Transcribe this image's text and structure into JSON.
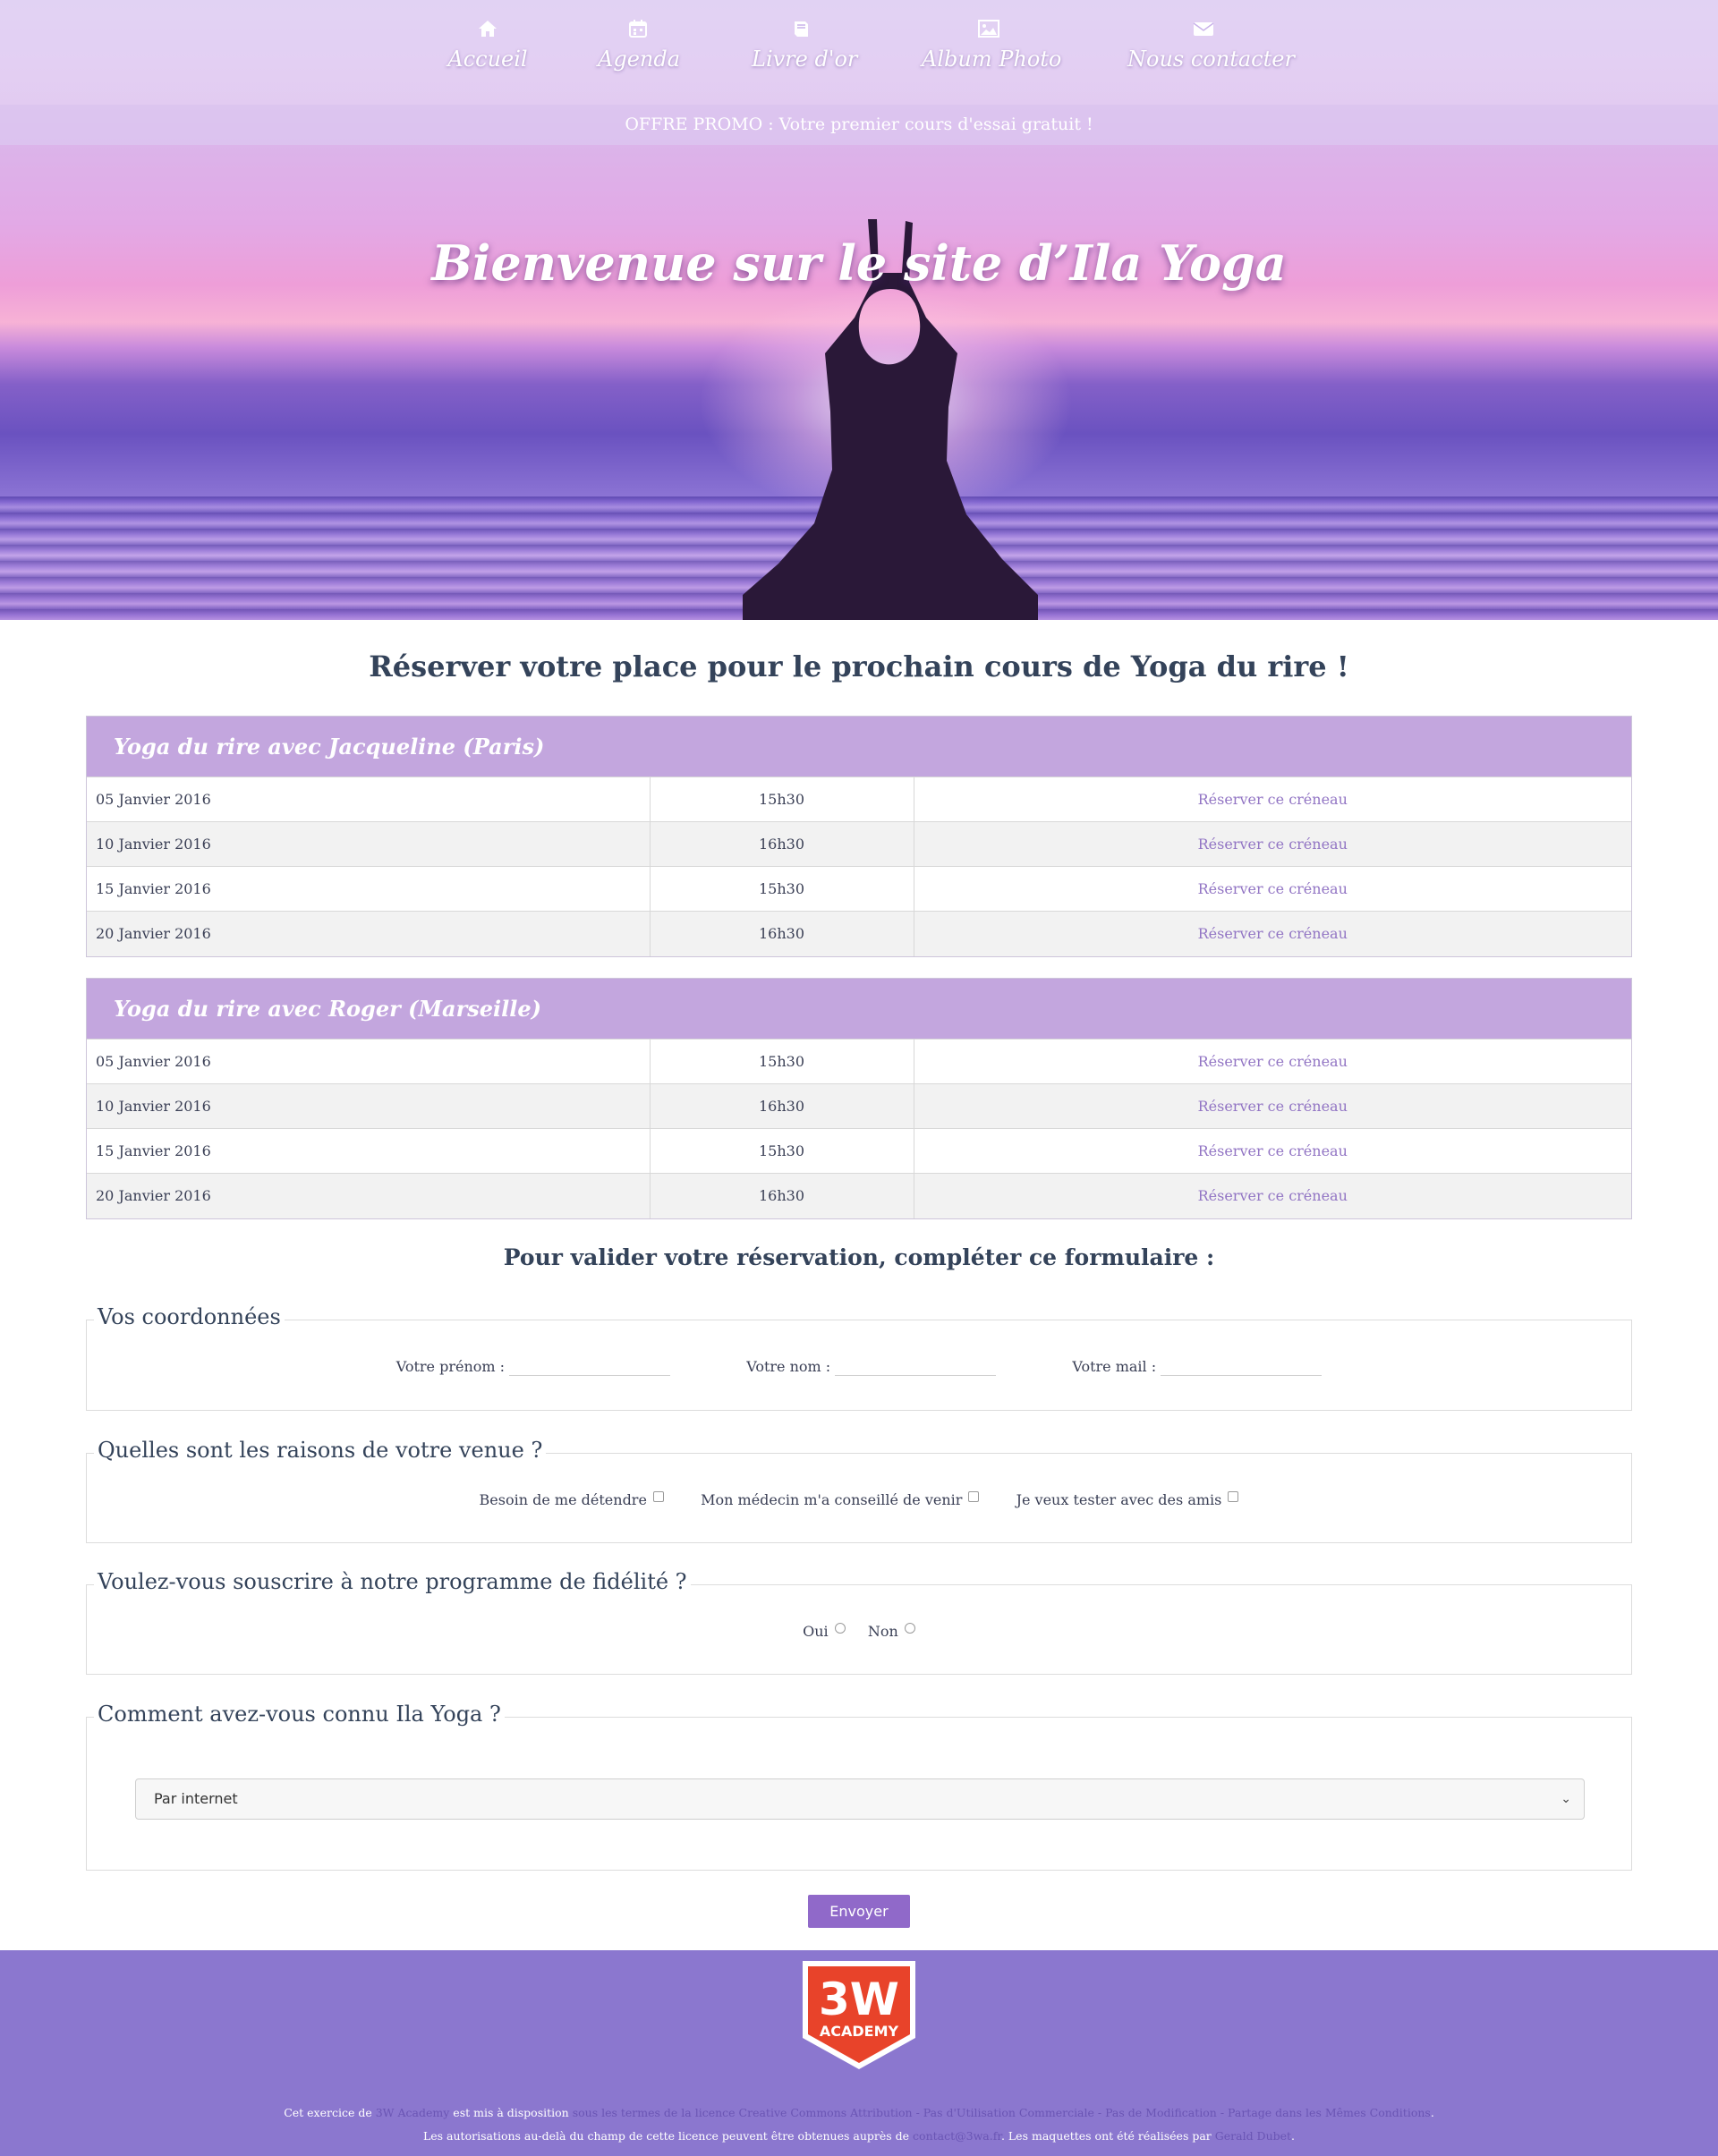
{
  "nav": {
    "items": [
      {
        "label": "Accueil",
        "icon": "home-icon"
      },
      {
        "label": "Agenda",
        "icon": "calendar-icon"
      },
      {
        "label": "Livre d'or",
        "icon": "book-icon"
      },
      {
        "label": "Album Photo",
        "icon": "picture-icon"
      },
      {
        "label": "Nous contacter",
        "icon": "envelope-icon"
      }
    ]
  },
  "promo": "OFFRE PROMO : Votre premier cours d'essai gratuit !",
  "hero": {
    "title": "Bienvenue sur le site d’Ila Yoga"
  },
  "booking": {
    "title": "Réserver votre place pour le prochain cours de Yoga du rire !",
    "schedules": [
      {
        "heading": "Yoga du rire avec Jacqueline (Paris)",
        "rows": [
          {
            "date": "05 Janvier 2016",
            "time": "15h30",
            "link": "Réserver ce créneau"
          },
          {
            "date": "10 Janvier 2016",
            "time": "16h30",
            "link": "Réserver ce créneau"
          },
          {
            "date": "15 Janvier 2016",
            "time": "15h30",
            "link": "Réserver ce créneau"
          },
          {
            "date": "20 Janvier 2016",
            "time": "16h30",
            "link": "Réserver ce créneau"
          }
        ]
      },
      {
        "heading": "Yoga du rire avec Roger (Marseille)",
        "rows": [
          {
            "date": "05 Janvier 2016",
            "time": "15h30",
            "link": "Réserver ce créneau"
          },
          {
            "date": "10 Janvier 2016",
            "time": "16h30",
            "link": "Réserver ce créneau"
          },
          {
            "date": "15 Janvier 2016",
            "time": "15h30",
            "link": "Réserver ce créneau"
          },
          {
            "date": "20 Janvier 2016",
            "time": "16h30",
            "link": "Réserver ce créneau"
          }
        ]
      }
    ]
  },
  "form": {
    "title": "Pour valider votre réservation, compléter ce formulaire :",
    "contact": {
      "legend": "Vos coordonnées",
      "firstname_label": "Votre prénom :",
      "lastname_label": "Votre nom :",
      "email_label": "Votre mail :"
    },
    "reasons": {
      "legend": "Quelles sont les raisons de votre venue ?",
      "options": [
        "Besoin de me détendre",
        "Mon médecin m'a conseillé de venir",
        "Je veux tester avec des amis"
      ]
    },
    "loyalty": {
      "legend": "Voulez-vous souscrire à notre programme de fidélité ?",
      "options": [
        "Oui",
        "Non"
      ]
    },
    "source": {
      "legend": "Comment avez-vous connu Ila Yoga ?",
      "selected": "Par internet"
    },
    "submit_label": "Envoyer"
  },
  "footer": {
    "logo_top": "3W",
    "logo_bottom": "ACADEMY",
    "line1_a": "Cet exercice de",
    "line1_b": "3W Academy",
    "line1_c": "est mis à disposition",
    "line1_d": "sous les termes de la licence Creative Commons Attribution - Pas d'Utilisation Commerciale - Pas de Modification - Partage dans les Mêmes Conditions",
    "line1_e": ".",
    "line2_a": "Les autorisations au-delà du champ de cette licence peuvent être obtenues auprès de",
    "line2_b": "contact@3wa.fr",
    "line2_c": ". Les maquettes ont été réalisées par",
    "line2_d": "Gerald Dubet",
    "line2_e": "."
  },
  "colors": {
    "accent": "#9069c9",
    "table_header": "#c3a6de",
    "footer_bg": "#8b77cf",
    "link": "#9275c4"
  }
}
